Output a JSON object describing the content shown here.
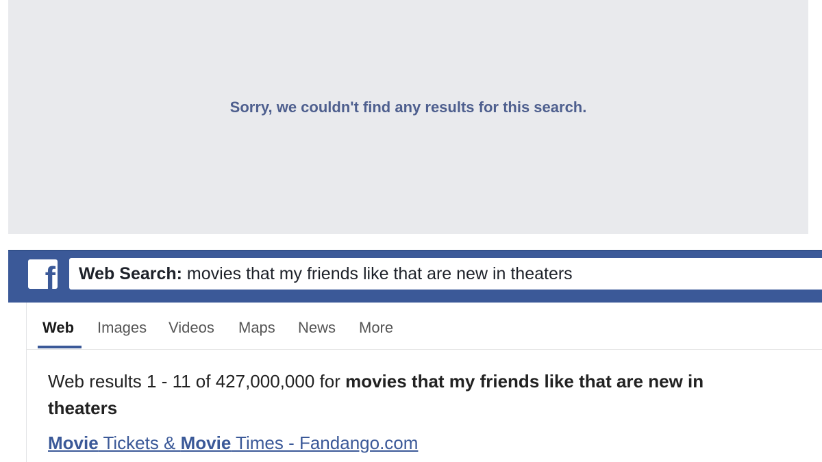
{
  "no_results": {
    "message": "Sorry, we couldn't find any results for this search."
  },
  "header": {
    "logo_glyph": "f",
    "logo_icon": "facebook-logo-icon",
    "search_prefix": "Web Search:",
    "search_query": " movies that my friends like that are new in theaters"
  },
  "tabs": [
    {
      "label": "Web",
      "active": true
    },
    {
      "label": "Images",
      "active": false
    },
    {
      "label": "Videos",
      "active": false
    },
    {
      "label": "Maps",
      "active": false
    },
    {
      "label": "News",
      "active": false
    },
    {
      "label": "More",
      "active": false
    }
  ],
  "results": {
    "summary_prefix": "Web results 1 - 11 of 427,000,000 for ",
    "summary_query": "movies that my friends like that are new in theaters",
    "first_result": {
      "part1_bold": "Movie",
      "part2": " Tickets & ",
      "part3_bold": "Movie",
      "part4": " Times - Fandango.com"
    }
  },
  "colors": {
    "brand_blue": "#3b5998",
    "panel_gray": "#e9eaed",
    "no_results_text": "#4e5f8e"
  }
}
